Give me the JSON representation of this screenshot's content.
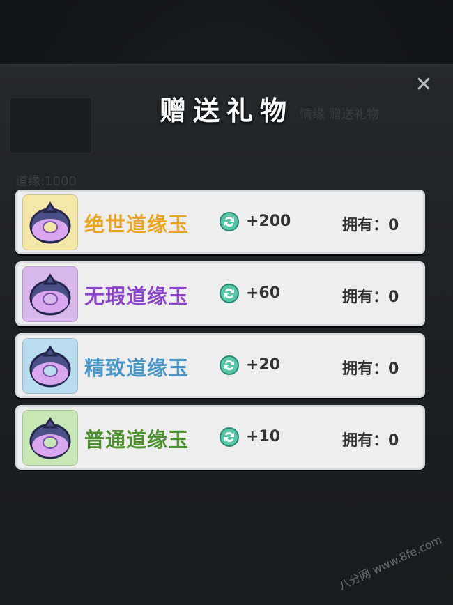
{
  "dialog": {
    "title": "赠送礼物"
  },
  "background": {
    "line_1": "道缘:1000",
    "line_2": "情缘 赠送礼物"
  },
  "ui_colors": {
    "card_bg": "#eeeeef",
    "tier_gold": "#e9a421",
    "tier_purple": "#8b45c9",
    "tier_blue": "#4a97c7",
    "tier_green": "#4e8f2f"
  },
  "gifts": [
    {
      "name": "绝世道缘玉",
      "favor": "+200",
      "owned": "拥有：0",
      "icon": "jade-ring-icon"
    },
    {
      "name": "无瑕道缘玉",
      "favor": "+60",
      "owned": "拥有：0",
      "icon": "jade-ring-icon"
    },
    {
      "name": "精致道缘玉",
      "favor": "+20",
      "owned": "拥有：0",
      "icon": "jade-ring-icon"
    },
    {
      "name": "普通道缘玉",
      "favor": "+10",
      "owned": "拥有：0",
      "icon": "jade-ring-icon"
    }
  ],
  "watermark": "八分网 www.8fe.com"
}
